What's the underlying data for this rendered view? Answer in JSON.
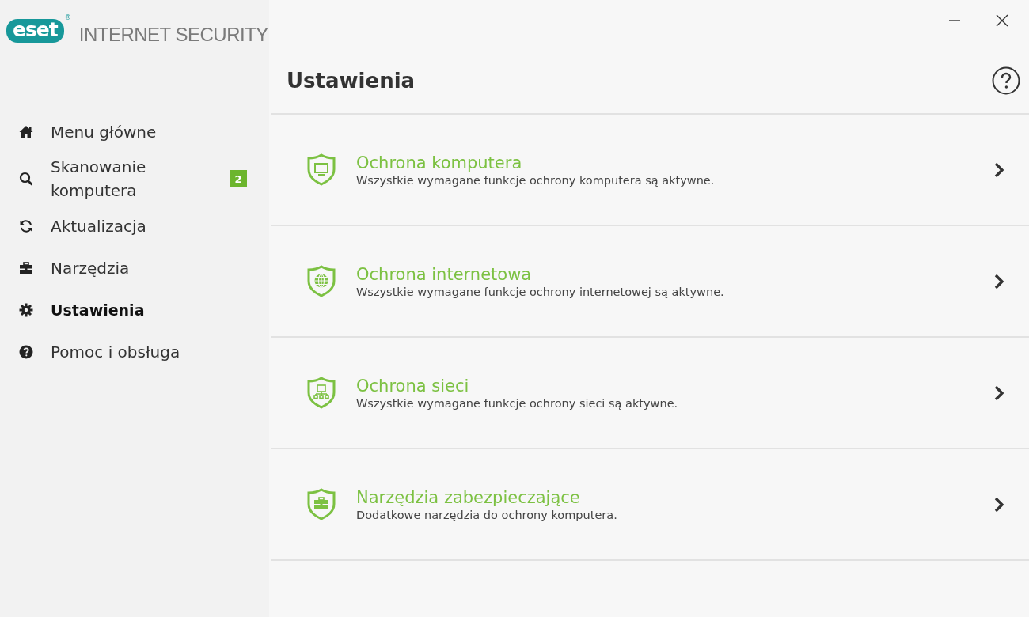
{
  "window": {
    "logo": {
      "mark": "eset",
      "registered": "®",
      "product": "INTERNET SECURITY"
    }
  },
  "sidebar": {
    "items": [
      {
        "kind": "home",
        "label": "Menu główne",
        "selected": false
      },
      {
        "kind": "search",
        "label": "Skanowanie komputera",
        "selected": false,
        "badge": "2"
      },
      {
        "kind": "update",
        "label": "Aktualizacja",
        "selected": false
      },
      {
        "kind": "tools",
        "label": "Narzędzia",
        "selected": false
      },
      {
        "kind": "settings",
        "label": "Ustawienia",
        "selected": true
      },
      {
        "kind": "help",
        "label": "Pomoc i obsługa",
        "selected": false
      }
    ]
  },
  "page": {
    "title": "Ustawienia",
    "sections": [
      {
        "kind": "computer",
        "title": "Ochrona komputera",
        "description": "Wszystkie wymagane funkcje ochrony komputera są aktywne."
      },
      {
        "kind": "internet",
        "title": "Ochrona internetowa",
        "description": "Wszystkie wymagane funkcje ochrony internetowej są aktywne."
      },
      {
        "kind": "network",
        "title": "Ochrona sieci",
        "description": "Wszystkie wymagane funkcje ochrony sieci są aktywne."
      },
      {
        "kind": "tools",
        "title": "Narzędzia zabezpieczające",
        "description": "Dodatkowe narzędzia do ochrony komputera."
      }
    ]
  }
}
